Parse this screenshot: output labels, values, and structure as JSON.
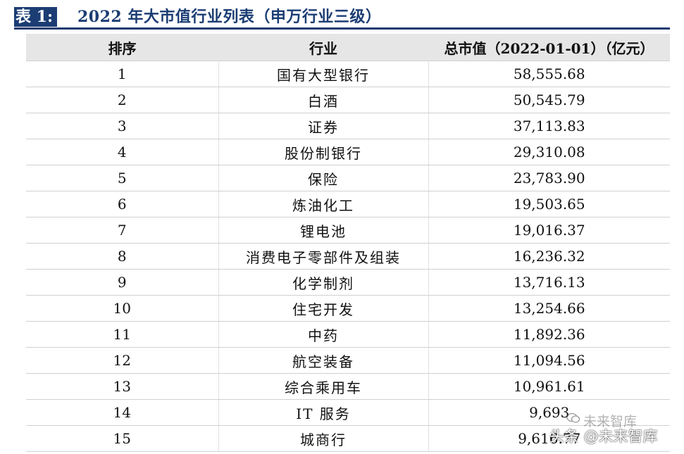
{
  "title": {
    "tag": "表 1:",
    "text": "2022 年大市值行业列表（申万行业三级）"
  },
  "table": {
    "headers": [
      "排序",
      "行业",
      "总市值（2022-01-01）（亿元）"
    ],
    "rows": [
      {
        "rank": "1",
        "industry": "国有大型银行",
        "value": "58,555.68"
      },
      {
        "rank": "2",
        "industry": "白酒",
        "value": "50,545.79"
      },
      {
        "rank": "3",
        "industry": "证券",
        "value": "37,113.83"
      },
      {
        "rank": "4",
        "industry": "股份制银行",
        "value": "29,310.08"
      },
      {
        "rank": "5",
        "industry": "保险",
        "value": "23,783.90"
      },
      {
        "rank": "6",
        "industry": "炼油化工",
        "value": "19,503.65"
      },
      {
        "rank": "7",
        "industry": "锂电池",
        "value": "19,016.37"
      },
      {
        "rank": "8",
        "industry": "消费电子零部件及组装",
        "value": "16,236.32"
      },
      {
        "rank": "9",
        "industry": "化学制剂",
        "value": "13,716.13"
      },
      {
        "rank": "10",
        "industry": "住宅开发",
        "value": "13,254.66"
      },
      {
        "rank": "11",
        "industry": "中药",
        "value": "11,892.36"
      },
      {
        "rank": "12",
        "industry": "航空装备",
        "value": "11,094.56"
      },
      {
        "rank": "13",
        "industry": "综合乘用车",
        "value": "10,961.61"
      },
      {
        "rank": "14",
        "industry": "IT 服务",
        "value": "9,693"
      },
      {
        "rank": "15",
        "industry": "城商行",
        "value": "9,616.77"
      }
    ]
  },
  "watermark": {
    "line1": "未来智库",
    "line2": "头条 @未来智库"
  },
  "colors": {
    "title_bg": "#1b3d73",
    "title_text": "#1b3d73",
    "header_bg": "#e6e6e6"
  }
}
